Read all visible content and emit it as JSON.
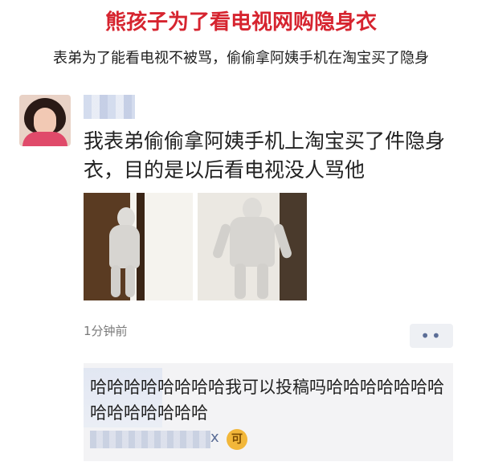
{
  "headline": "熊孩子为了看电视网购隐身衣",
  "subline": "表弟为了能看电视不被骂，偷偷拿阿姨手机在淘宝买了隐身",
  "post": {
    "text": "我表弟偷偷拿阿姨手机上淘宝买了件隐身衣，目的是以后看电视没人骂他",
    "timestamp": "1分钟前",
    "more_label": "••"
  },
  "comment": {
    "text": "哈哈哈哈哈哈哈哈我可以投稿吗哈哈哈哈哈哈哈哈哈哈哈哈哈哈",
    "suffix": "x",
    "emoji": "可"
  }
}
